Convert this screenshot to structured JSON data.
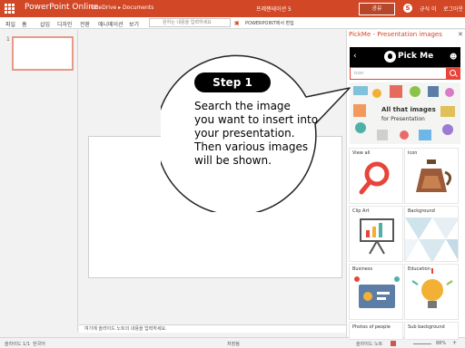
{
  "titlebar": {
    "app_name": "PowerPoint Online",
    "breadcrumb": "OneDrive ▸ Documents",
    "document_title": "프레젠테이션 5",
    "share_label": "공유",
    "skype_label": "S",
    "user_name": "규식 이",
    "signout_label": "로그아웃"
  },
  "ribbon": {
    "tabs": [
      "파일",
      "홈",
      "삽입",
      "디자인",
      "전환",
      "애니메이션",
      "보기"
    ],
    "tell_me_placeholder": "원하는 내용을 입력하세요",
    "open_in_app": "POWERPOINT에서 편집"
  },
  "rail": {
    "slide_number": "1"
  },
  "notes": {
    "placeholder": "여기에 슬라이드 노트의 내용을 입력하세요."
  },
  "status": {
    "slide_info": "슬라이드 1/1",
    "language": "한국어",
    "saved": "저장됨",
    "notes_label": "슬라이드 노트",
    "zoom": "88%"
  },
  "pane": {
    "title": "PickMe - Presentation images",
    "close": "✕",
    "header": {
      "back": "‹",
      "brand": "Pick Me",
      "user_icon": "user-icon"
    },
    "search_placeholder": "icon",
    "banner": {
      "line1": "All that images",
      "line2": "for Presentation"
    },
    "categories": [
      "View all",
      "Icon",
      "Clip Art",
      "Background",
      "Business",
      "Education",
      "Photos of people",
      "Sub background"
    ]
  },
  "callout": {
    "step": "Step 1",
    "lines": [
      "Search the image",
      "you want to insert into",
      "your presentation.",
      "Then various images",
      "will be shown."
    ]
  },
  "colors": {
    "accent": "#d24726",
    "pickme_red": "#e8443a"
  }
}
